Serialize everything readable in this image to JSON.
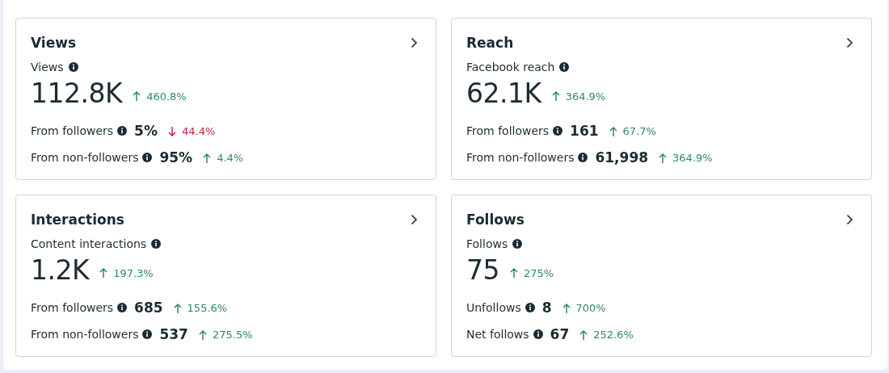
{
  "cards": [
    {
      "title": "Views",
      "metric_label": "Views",
      "value": "112.8K",
      "change": {
        "increase": true,
        "text": "460.8%"
      },
      "breakdown": [
        {
          "label": "From followers",
          "value": "5%",
          "change": {
            "increase": false,
            "text": "44.4%"
          }
        },
        {
          "label": "From non-followers",
          "value": "95%",
          "change": {
            "increase": true,
            "text": "4.4%"
          }
        }
      ]
    },
    {
      "title": "Reach",
      "metric_label": "Facebook reach",
      "value": "62.1K",
      "change": {
        "increase": true,
        "text": "364.9%"
      },
      "breakdown": [
        {
          "label": "From followers",
          "value": "161",
          "change": {
            "increase": true,
            "text": "67.7%"
          }
        },
        {
          "label": "From non-followers",
          "value": "61,998",
          "change": {
            "increase": true,
            "text": "364.9%"
          }
        }
      ]
    },
    {
      "title": "Interactions",
      "metric_label": "Content interactions",
      "value": "1.2K",
      "change": {
        "increase": true,
        "text": "197.3%"
      },
      "breakdown": [
        {
          "label": "From followers",
          "value": "685",
          "change": {
            "increase": true,
            "text": "155.6%"
          }
        },
        {
          "label": "From non-followers",
          "value": "537",
          "change": {
            "increase": true,
            "text": "275.5%"
          }
        }
      ]
    },
    {
      "title": "Follows",
      "metric_label": "Follows",
      "value": "75",
      "change": {
        "increase": true,
        "text": "275%"
      },
      "breakdown": [
        {
          "label": "Unfollows",
          "value": "8",
          "change": {
            "increase": true,
            "text": "700%"
          }
        },
        {
          "label": "Net follows",
          "value": "67",
          "change": {
            "increase": true,
            "text": "252.6%"
          }
        }
      ]
    }
  ]
}
